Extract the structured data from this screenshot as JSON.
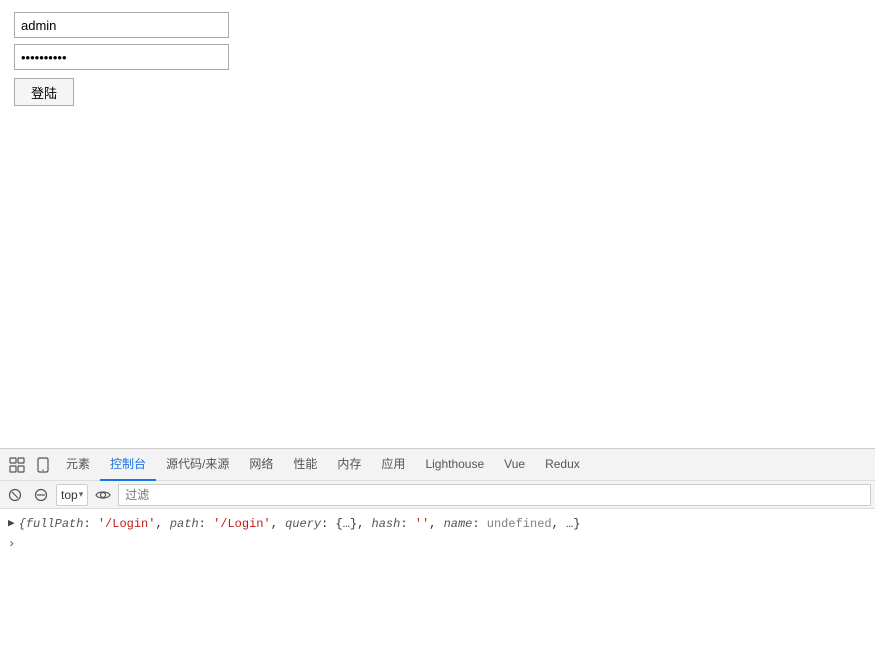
{
  "login": {
    "username_value": "admin",
    "password_placeholder": "••••••••••",
    "button_label": "登陆"
  },
  "devtools": {
    "tabs": [
      {
        "label": "元素",
        "active": false
      },
      {
        "label": "控制台",
        "active": true
      },
      {
        "label": "源代码/来源",
        "active": false
      },
      {
        "label": "网络",
        "active": false
      },
      {
        "label": "性能",
        "active": false
      },
      {
        "label": "内存",
        "active": false
      },
      {
        "label": "应用",
        "active": false
      },
      {
        "label": "Lighthouse",
        "active": false
      },
      {
        "label": "Vue",
        "active": false
      },
      {
        "label": "Redux",
        "active": false
      }
    ],
    "context": "top",
    "filter_placeholder": "过滤",
    "console_output": "{fullPath: '/Login', path: '/Login', query: {…}, hash: '', name: undefined, …}"
  }
}
